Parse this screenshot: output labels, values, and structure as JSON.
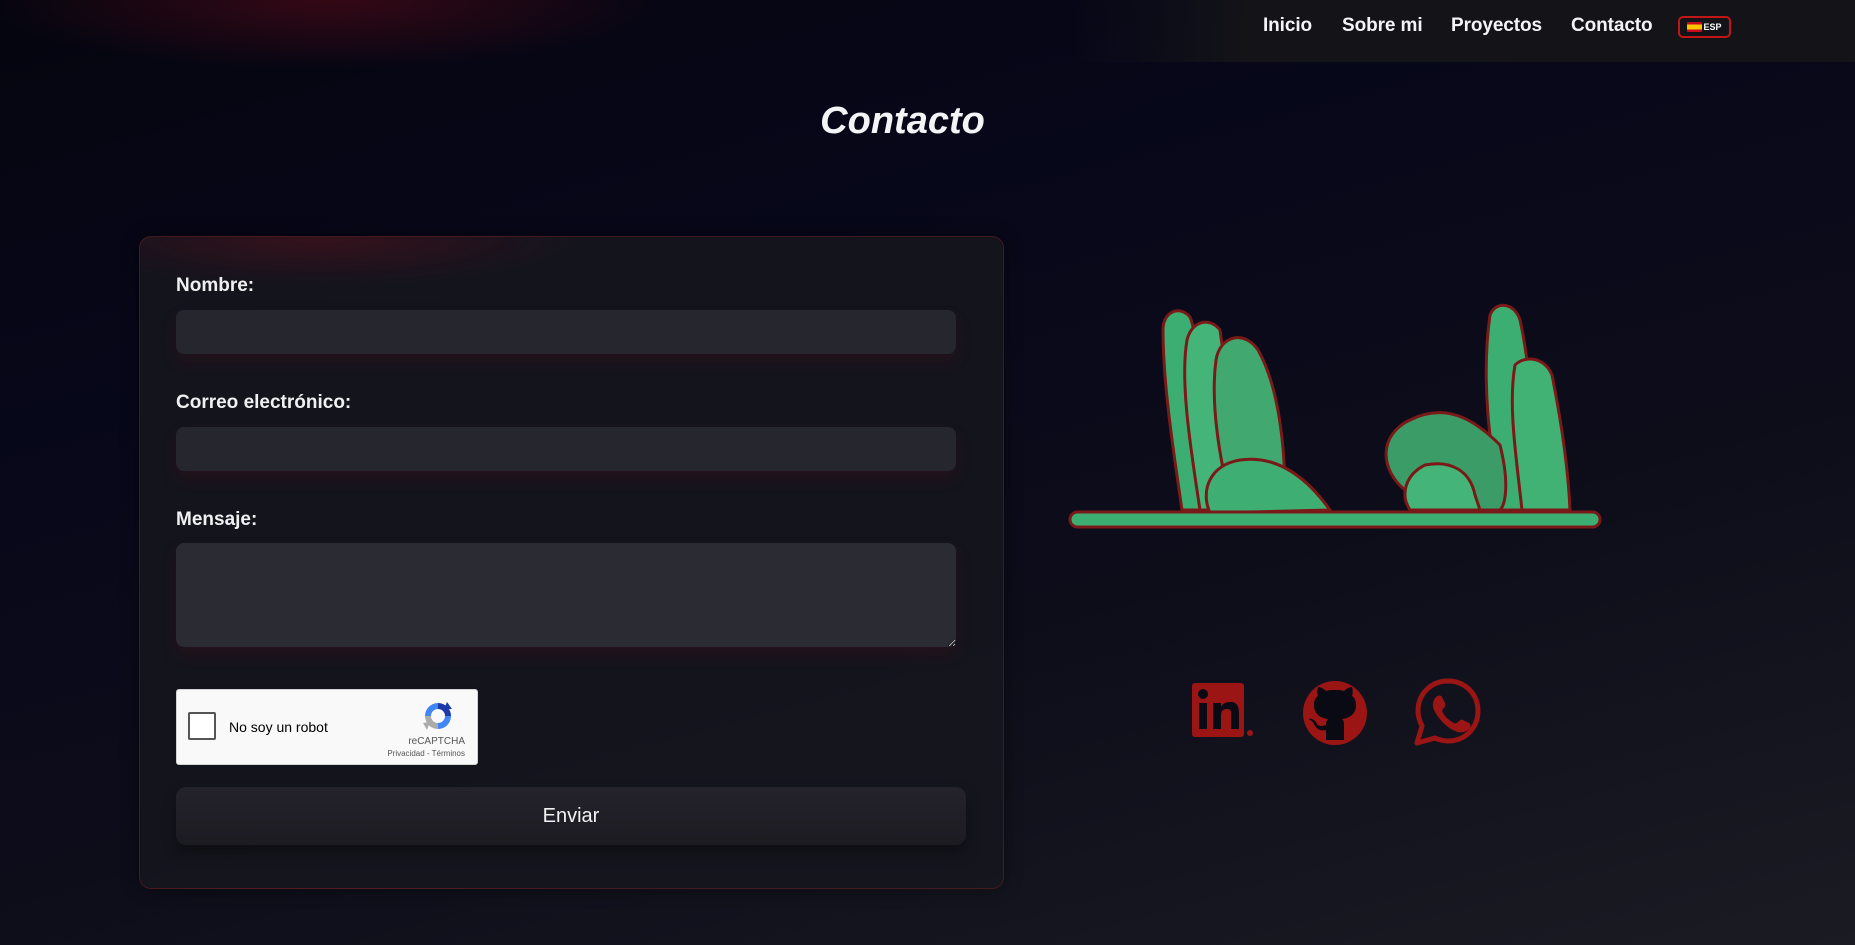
{
  "nav": {
    "links": [
      {
        "label": "Inicio"
      },
      {
        "label": "Sobre mi"
      },
      {
        "label": "Proyectos"
      },
      {
        "label": "Contacto"
      }
    ],
    "language": {
      "label": "ESP",
      "flag": "spain-flag-icon"
    }
  },
  "page": {
    "title": "Contacto"
  },
  "form": {
    "name_label": "Nombre:",
    "name_value": "",
    "email_label": "Correo electrónico:",
    "email_value": "",
    "message_label": "Mensaje:",
    "message_value": "",
    "recaptcha": {
      "label": "No soy un robot",
      "brand": "reCAPTCHA",
      "privacy": "Privacidad",
      "separator": "-",
      "terms": "Términos",
      "checked": false
    },
    "submit_label": "Enviar"
  },
  "illustration": {
    "icon": "waving-hands-illustration",
    "hand_color": "#3dae72",
    "outline_color": "#7a1a18"
  },
  "social": [
    {
      "name": "linkedin-icon"
    },
    {
      "name": "github-icon"
    },
    {
      "name": "whatsapp-icon"
    }
  ],
  "colors": {
    "accent": "#c21515",
    "social_icon": "#9b1515",
    "background": "#07071a",
    "card": "#16161e",
    "input": "#26262f"
  }
}
